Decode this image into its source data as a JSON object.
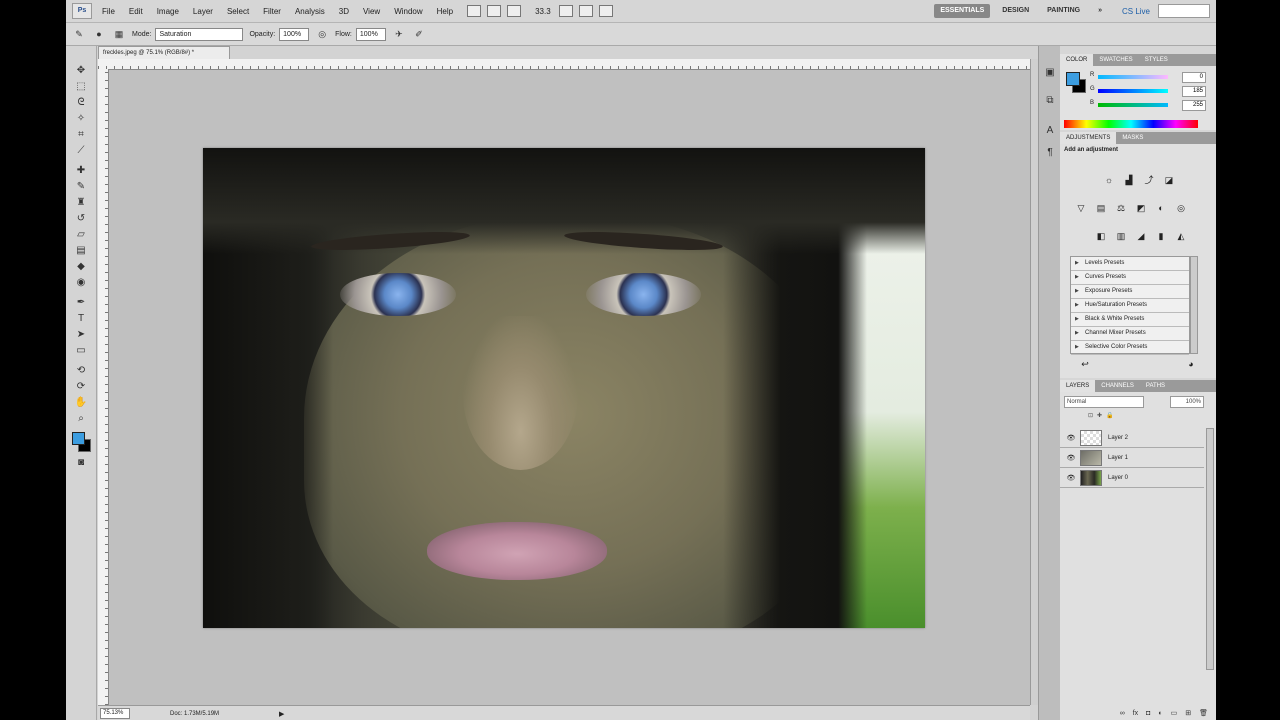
{
  "menubar": {
    "logo": "Ps",
    "items": [
      "File",
      "Edit",
      "Image",
      "Layer",
      "Select",
      "Filter",
      "Analysis",
      "3D",
      "View",
      "Window",
      "Help"
    ],
    "zoom": "33.3",
    "workspaces": [
      "ESSENTIALS",
      "DESIGN",
      "PAINTING"
    ],
    "overflow": "»",
    "cs_live": "CS Live"
  },
  "optbar": {
    "mode_label": "Mode:",
    "mode_value": "Saturation",
    "opacity_label": "Opacity:",
    "opacity_value": "100%",
    "flow_label": "Flow:",
    "flow_value": "100%"
  },
  "document": {
    "tab_title": "freckles.jpeg @ 75.1% (RGB/8#) *",
    "status_zoom": "75.13%",
    "status_doc": "Doc: 1.73M/5.19M"
  },
  "colors": {
    "foreground": "#3c9de0",
    "background": "#000000",
    "accent": "#1c5ea8"
  },
  "color_panel": {
    "tabs": [
      "COLOR",
      "SWATCHES",
      "STYLES"
    ],
    "channels": [
      {
        "label": "R",
        "value": "0"
      },
      {
        "label": "G",
        "value": "185"
      },
      {
        "label": "B",
        "value": "255"
      }
    ]
  },
  "adjustments_panel": {
    "tabs": [
      "ADJUSTMENTS",
      "MASKS"
    ],
    "title": "Add an adjustment",
    "presets": [
      "Levels Presets",
      "Curves Presets",
      "Exposure Presets",
      "Hue/Saturation Presets",
      "Black & White Presets",
      "Channel Mixer Presets",
      "Selective Color Presets"
    ]
  },
  "layers_panel": {
    "tabs": [
      "LAYERS",
      "CHANNELS",
      "PATHS"
    ],
    "blend_mode": "Normal",
    "opacity": "100%",
    "layers": [
      {
        "name": "Layer 2",
        "visible": "true"
      },
      {
        "name": "Layer 1",
        "visible": "true"
      },
      {
        "name": "Layer 0",
        "visible": "true"
      }
    ]
  }
}
